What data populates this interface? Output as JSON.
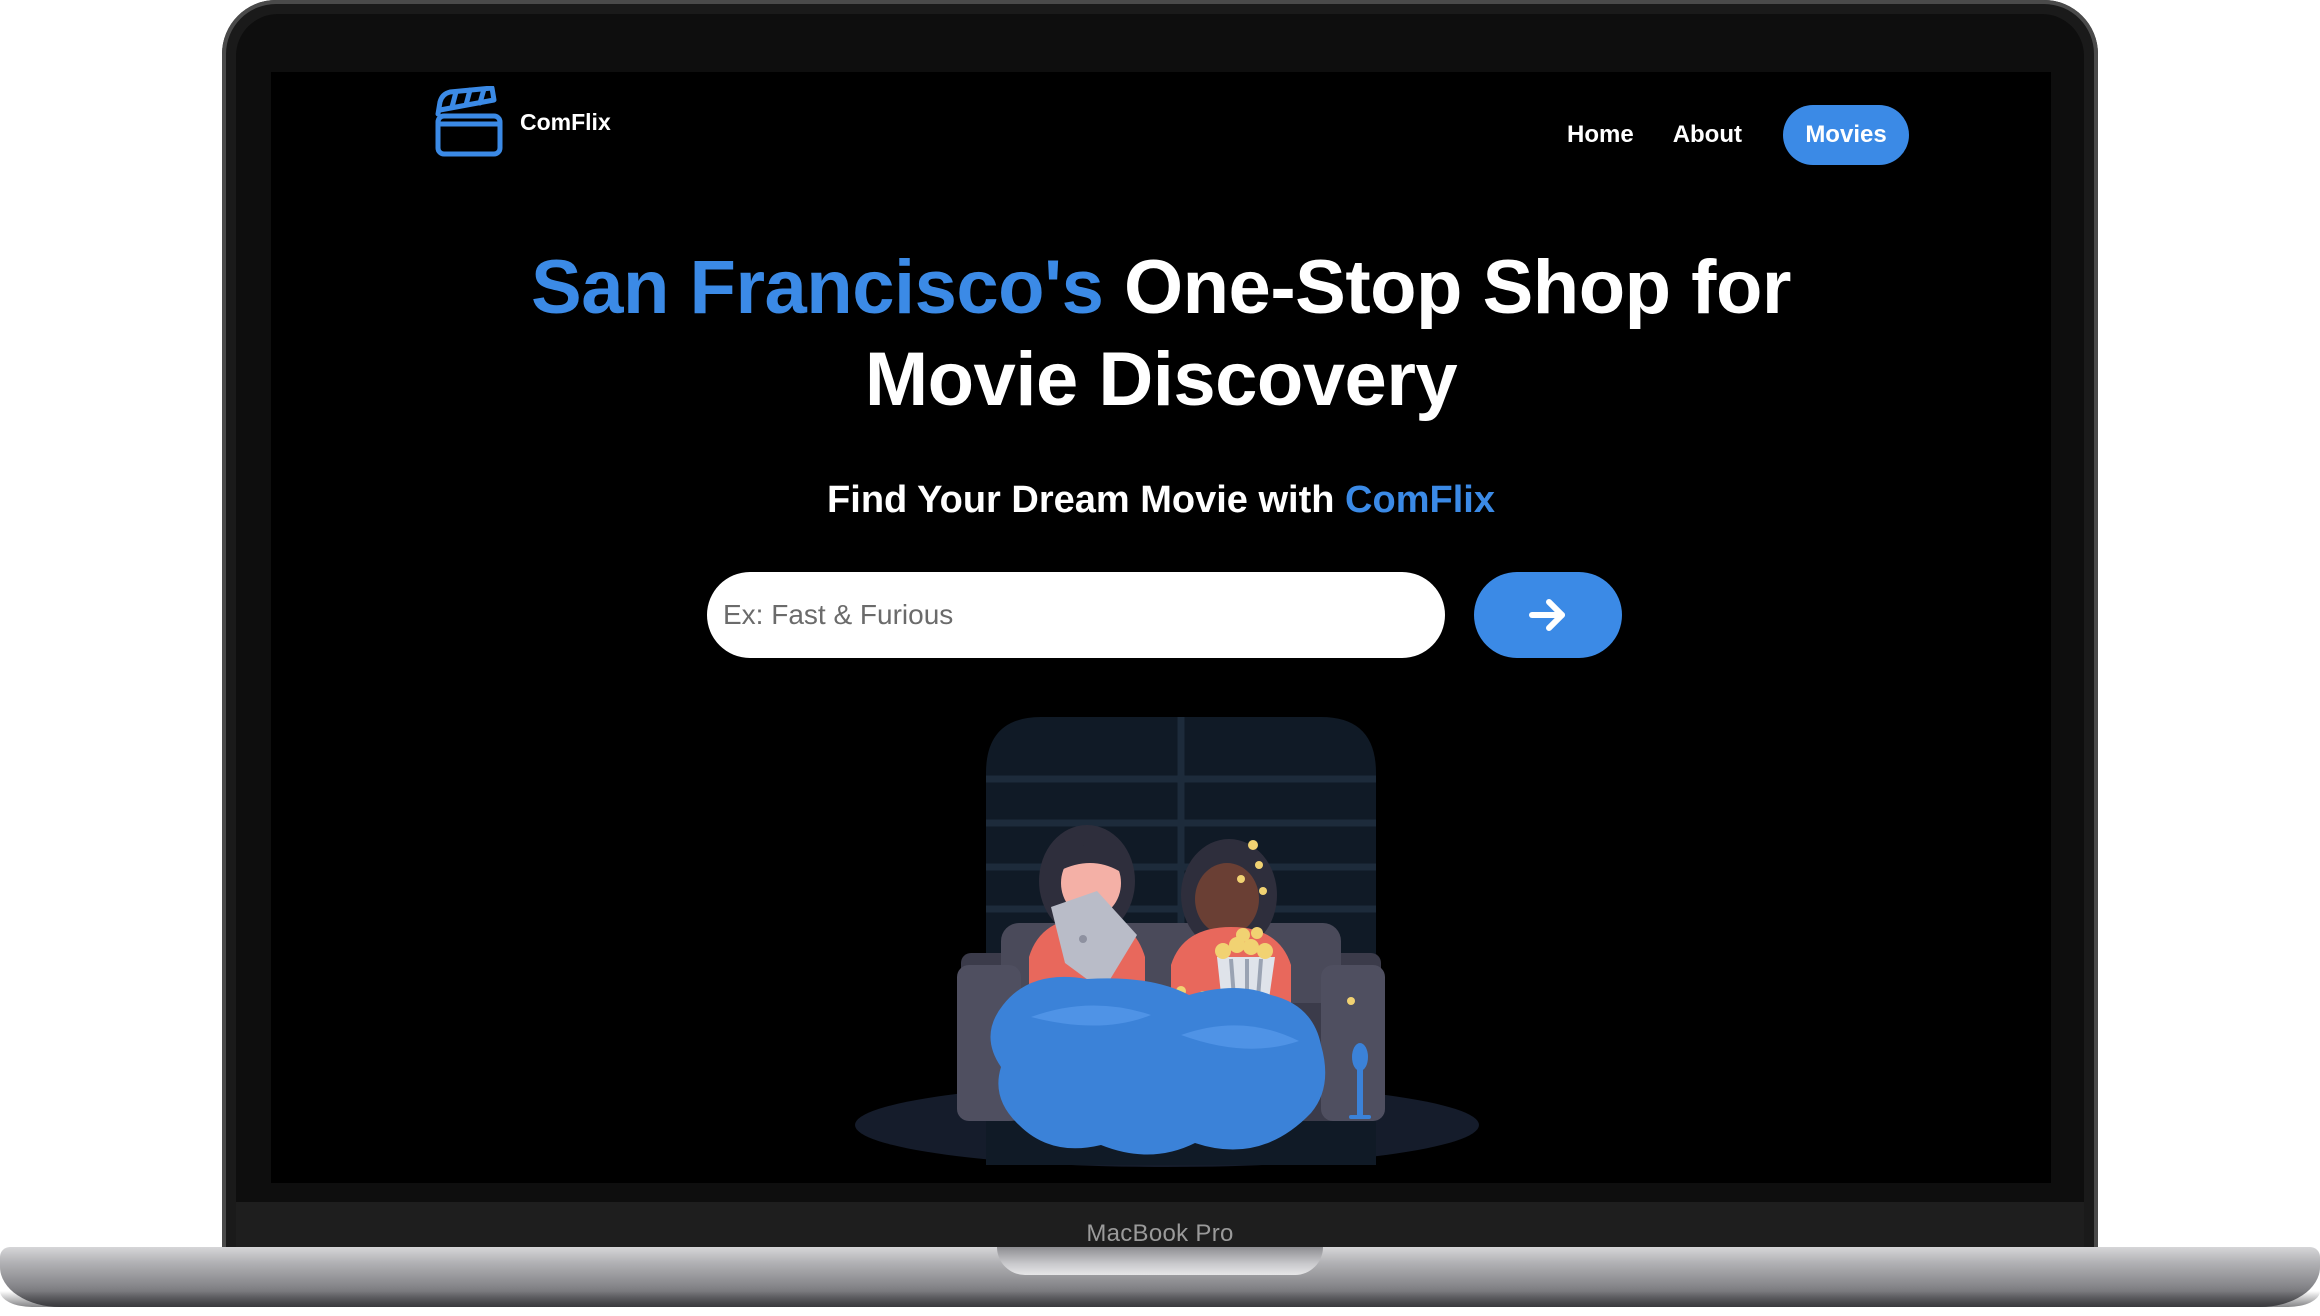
{
  "device": {
    "model_label": "MacBook Pro"
  },
  "brand": {
    "name": "ComFlix",
    "accent_color": "#3b8ae6"
  },
  "nav": {
    "home": "Home",
    "about": "About",
    "movies": "Movies"
  },
  "hero": {
    "headline_accent": "San Francisco's",
    "headline_rest_line1": " One-Stop Shop for",
    "headline_line2": "Movie Discovery",
    "subheadline_prefix": "Find Your Dream Movie with ",
    "subheadline_brand": "ComFlix"
  },
  "search": {
    "placeholder": "Ex: Fast & Furious",
    "value": "",
    "button_icon": "arrow-right-icon"
  },
  "illustration": {
    "icon": "movie-night-illustration"
  }
}
